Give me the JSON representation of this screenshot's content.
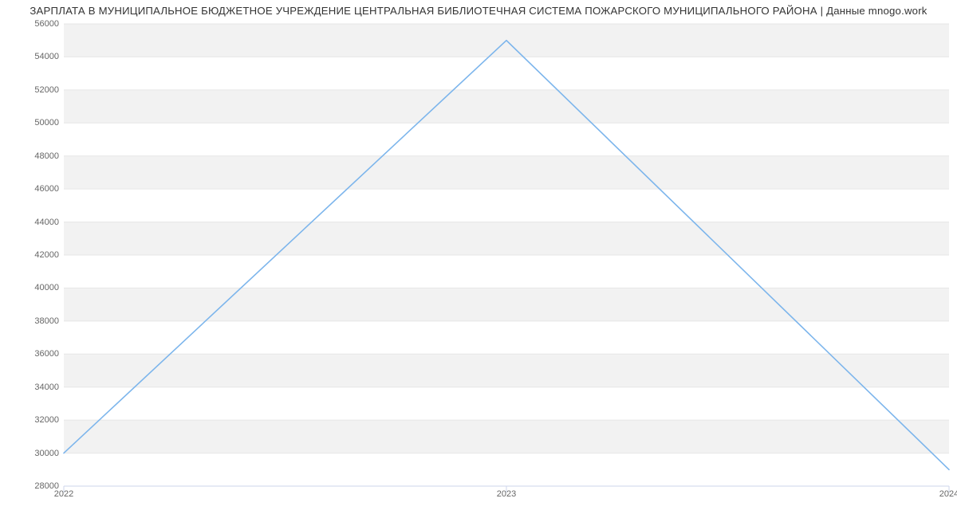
{
  "chart_data": {
    "type": "line",
    "title": "ЗАРПЛАТА В МУНИЦИПАЛЬНОЕ БЮДЖЕТНОЕ УЧРЕЖДЕНИЕ ЦЕНТРАЛЬНАЯ БИБЛИОТЕЧНАЯ СИСТЕМА ПОЖАРСКОГО МУНИЦИПАЛЬНОГО РАЙОНА | Данные mnogo.work",
    "x": [
      2022,
      2023,
      2024
    ],
    "values": [
      30000,
      55000,
      29000
    ],
    "x_ticks": [
      2022,
      2023,
      2024
    ],
    "y_ticks": [
      28000,
      30000,
      32000,
      34000,
      36000,
      38000,
      40000,
      42000,
      44000,
      46000,
      48000,
      50000,
      52000,
      54000,
      56000
    ],
    "ylim": [
      28000,
      56000
    ],
    "xlim": [
      2022,
      2024
    ],
    "line_color": "#7cb5ec",
    "grid_band_color": "#f2f2f2",
    "grid_line_color": "#e6e6e6",
    "axis_line_color": "#ccd6eb"
  }
}
